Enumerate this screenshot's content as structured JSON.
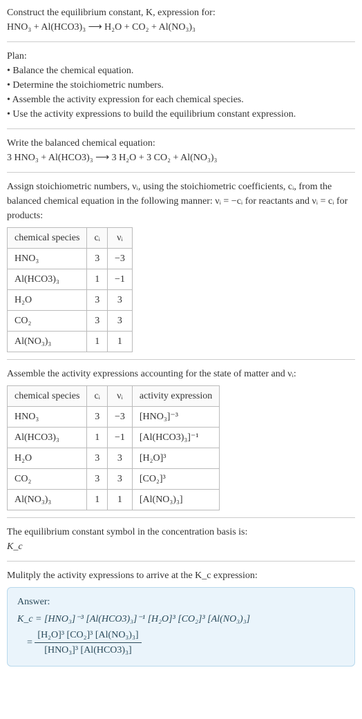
{
  "intro": {
    "line1": "Construct the equilibrium constant, K, expression for:",
    "reaction_unbalanced": "HNO₃ + Al(HCO3)₃  ⟶  H₂O + CO₂ + Al(NO₃)₃"
  },
  "plan": {
    "heading": "Plan:",
    "items": [
      "• Balance the chemical equation.",
      "• Determine the stoichiometric numbers.",
      "• Assemble the activity expression for each chemical species.",
      "• Use the activity expressions to build the equilibrium constant expression."
    ]
  },
  "balanced": {
    "heading": "Write the balanced chemical equation:",
    "reaction": "3 HNO₃ + Al(HCO3)₃  ⟶  3 H₂O + 3 CO₂ + Al(NO₃)₃"
  },
  "assign": {
    "text": "Assign stoichiometric numbers, νᵢ, using the stoichiometric coefficients, cᵢ, from the balanced chemical equation in the following manner: νᵢ = −cᵢ for reactants and νᵢ = cᵢ for products:",
    "table": {
      "headers": [
        "chemical species",
        "cᵢ",
        "νᵢ"
      ],
      "rows": [
        [
          "HNO₃",
          "3",
          "−3"
        ],
        [
          "Al(HCO3)₃",
          "1",
          "−1"
        ],
        [
          "H₂O",
          "3",
          "3"
        ],
        [
          "CO₂",
          "3",
          "3"
        ],
        [
          "Al(NO₃)₃",
          "1",
          "1"
        ]
      ]
    }
  },
  "activity": {
    "text": "Assemble the activity expressions accounting for the state of matter and νᵢ:",
    "table": {
      "headers": [
        "chemical species",
        "cᵢ",
        "νᵢ",
        "activity expression"
      ],
      "rows": [
        [
          "HNO₃",
          "3",
          "−3",
          "[HNO₃]⁻³"
        ],
        [
          "Al(HCO3)₃",
          "1",
          "−1",
          "[Al(HCO3)₃]⁻¹"
        ],
        [
          "H₂O",
          "3",
          "3",
          "[H₂O]³"
        ],
        [
          "CO₂",
          "3",
          "3",
          "[CO₂]³"
        ],
        [
          "Al(NO₃)₃",
          "1",
          "1",
          "[Al(NO₃)₃]"
        ]
      ]
    }
  },
  "symbol": {
    "line1": "The equilibrium constant symbol in the concentration basis is:",
    "line2": "K_c"
  },
  "multiply": {
    "text": "Mulitply the activity expressions to arrive at the K_c expression:"
  },
  "answer": {
    "title": "Answer:",
    "line1": "K_c = [HNO₃]⁻³ [Al(HCO3)₃]⁻¹ [H₂O]³ [CO₂]³ [Al(NO₃)₃]",
    "eq": "=",
    "frac_num": "[H₂O]³ [CO₂]³ [Al(NO₃)₃]",
    "frac_den": "[HNO₃]³ [Al(HCO3)₃]"
  },
  "chart_data": {
    "type": "table",
    "tables": [
      {
        "title": "Stoichiometric numbers",
        "headers": [
          "chemical species",
          "c_i",
          "v_i"
        ],
        "rows": [
          {
            "species": "HNO3",
            "c_i": 3,
            "v_i": -3
          },
          {
            "species": "Al(HCO3)3",
            "c_i": 1,
            "v_i": -1
          },
          {
            "species": "H2O",
            "c_i": 3,
            "v_i": 3
          },
          {
            "species": "CO2",
            "c_i": 3,
            "v_i": 3
          },
          {
            "species": "Al(NO3)3",
            "c_i": 1,
            "v_i": 1
          }
        ]
      },
      {
        "title": "Activity expressions",
        "headers": [
          "chemical species",
          "c_i",
          "v_i",
          "activity expression"
        ],
        "rows": [
          {
            "species": "HNO3",
            "c_i": 3,
            "v_i": -3,
            "activity": "[HNO3]^-3"
          },
          {
            "species": "Al(HCO3)3",
            "c_i": 1,
            "v_i": -1,
            "activity": "[Al(HCO3)3]^-1"
          },
          {
            "species": "H2O",
            "c_i": 3,
            "v_i": 3,
            "activity": "[H2O]^3"
          },
          {
            "species": "CO2",
            "c_i": 3,
            "v_i": 3,
            "activity": "[CO2]^3"
          },
          {
            "species": "Al(NO3)3",
            "c_i": 1,
            "v_i": 1,
            "activity": "[Al(NO3)3]"
          }
        ]
      }
    ]
  }
}
